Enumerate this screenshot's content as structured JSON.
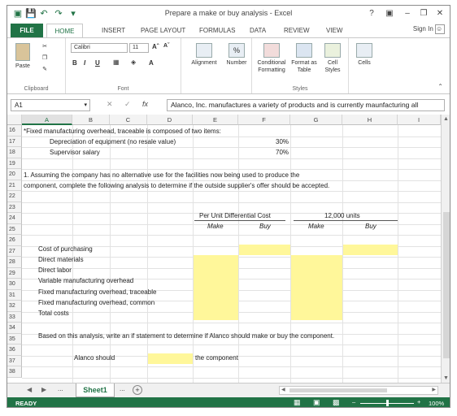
{
  "window": {
    "title": "Prepare a make or buy analysis - Excel",
    "help": "?",
    "sign_in": "Sign In"
  },
  "ribbon_tabs": [
    "FILE",
    "HOME",
    "INSERT",
    "PAGE LAYOUT",
    "FORMULAS",
    "DATA",
    "REVIEW",
    "VIEW"
  ],
  "ribbon": {
    "paste": "Paste",
    "clipboard": "Clipboard",
    "font_name": "Calibri",
    "font_size": "11",
    "font_group": "Font",
    "bold": "B",
    "italic": "I",
    "underline": "U",
    "alignment": "Alignment",
    "number": "Number",
    "number_symbol": "%",
    "conditional_formatting": "Conditional Formatting",
    "format_as_table": "Format as Table",
    "cell_styles": "Cell Styles",
    "styles_group": "Styles",
    "cells": "Cells"
  },
  "formula_bar": {
    "name_box": "A1",
    "fx": "fx",
    "content": "Alanco, Inc. manufactures a variety of products and is currently maunfacturing all"
  },
  "columns": [
    "A",
    "B",
    "C",
    "D",
    "E",
    "F",
    "G",
    "H",
    "I"
  ],
  "rows": [
    "16",
    "17",
    "18",
    "19",
    "20",
    "21",
    "22",
    "23",
    "24",
    "25",
    "26",
    "27",
    "28",
    "29",
    "30",
    "31",
    "32",
    "33",
    "34",
    "35",
    "36",
    "37",
    "38"
  ],
  "cells": {
    "r16": "*Fixed manufacturing overhead, traceable is composed of two items:",
    "r17_label": "Depreciation of equipment (no resale value)",
    "r17_val": "30%",
    "r18_label": "Supervisor salary",
    "r18_val": "70%",
    "r20": "1. Assuming the company has no alternative use for the facilities now being used to produce the",
    "r21": "component, complete the following analysis to determine if the outside supplier's offer should be accepted.",
    "r23_per_unit": "Per Unit Differential Cost",
    "r23_units": "12,000 units",
    "r24_make1": "Make",
    "r24_buy1": "Buy",
    "r24_make2": "Make",
    "r24_buy2": "Buy",
    "r26": "Cost of purchasing",
    "r27": "Direct materials",
    "r28": "Direct labor",
    "r29": "Variable manufacturing overhead",
    "r30": "Fixed manufacturing overhead, traceable",
    "r31": "Fixed manufacturing overhead, common",
    "r32": "Total costs",
    "r34": "Based on this analysis, write an if statement to determine if Alanco should make or buy the component.",
    "r36_a": "Alanco should",
    "r36_b": "the component"
  },
  "sheet_tabs": {
    "ellipsis": "...",
    "active": "Sheet1",
    "ellipsis2": "...",
    "add": "+"
  },
  "status": {
    "mode": "READY",
    "zoom": "100%"
  },
  "colors": {
    "excel_green": "#217346",
    "input_yellow": "#fff79a"
  }
}
